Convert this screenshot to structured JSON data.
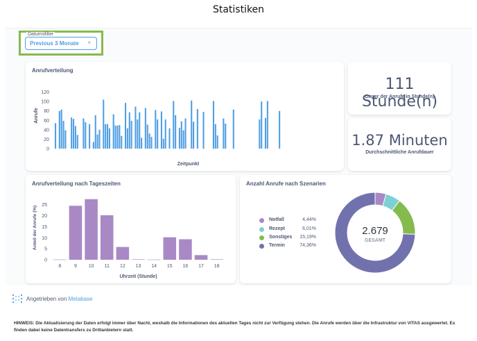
{
  "page": {
    "title": "Statistiken"
  },
  "filter": {
    "legend": "Datumsfilter",
    "value": "Previous 3 Monate",
    "close": "×"
  },
  "cards": {
    "duration": {
      "value": "111 Stunde(n)",
      "label": "Dauer der Anrufe in Stunde(n)"
    },
    "average": {
      "value": "1.87 Minuten",
      "label": "Durchschnittliche Anrufdauer"
    }
  },
  "chart_data": [
    {
      "type": "bar",
      "title": "Anrufverteilung",
      "xlabel": "Zeitpunkt",
      "ylabel": "Anrufe",
      "ylim": [
        0,
        140
      ],
      "yticks": [
        0,
        20,
        40,
        60,
        80,
        100,
        120
      ],
      "color": "#509ee3",
      "values": [
        54,
        0,
        80,
        83,
        59,
        39,
        0,
        0,
        66,
        63,
        48,
        29,
        0,
        0,
        64,
        56,
        0,
        52,
        0,
        14,
        71,
        30,
        40,
        0,
        104,
        52,
        52,
        43,
        0,
        73,
        49,
        49,
        50,
        27,
        0,
        97,
        43,
        77,
        59,
        0,
        89,
        62,
        77,
        23,
        0,
        86,
        51,
        32,
        25,
        0,
        82,
        62,
        0,
        79,
        21,
        62,
        0,
        43,
        0,
        101,
        71,
        0,
        44,
        58,
        39,
        64,
        0,
        0,
        102,
        57,
        0,
        84,
        0,
        0,
        78,
        0,
        0,
        0,
        0,
        101,
        52,
        28,
        0,
        0,
        64,
        53,
        0,
        0,
        0,
        83,
        0,
        0,
        0,
        0,
        0,
        0,
        0,
        0,
        0,
        0,
        0,
        0,
        62,
        100,
        0,
        65,
        101,
        0,
        0,
        0,
        0,
        0,
        80,
        0,
        0,
        0,
        0,
        0,
        0,
        0,
        0,
        0,
        0,
        0,
        0,
        0,
        0,
        0,
        0,
        0,
        0,
        0,
        0,
        0,
        0,
        0,
        0,
        0,
        0
      ]
    },
    {
      "type": "bar",
      "title": "Anrufverteilung nach Tageszeiten",
      "xlabel": "Uhrzeit (Stunde)",
      "ylabel": "Anteil der Anrufe (%)",
      "ylim": [
        0,
        29
      ],
      "yticks": [
        0,
        5,
        10,
        15,
        20,
        25
      ],
      "color": "#a989c5",
      "categories": [
        "8",
        "9",
        "10",
        "11",
        "12",
        "13",
        "14",
        "15",
        "16",
        "17",
        "18"
      ],
      "values": [
        0.1,
        24.5,
        27.5,
        20.2,
        5.8,
        0.2,
        0.1,
        10.2,
        9.3,
        2.1,
        0.2
      ]
    },
    {
      "type": "pie",
      "title": "Anzahl Anrufe nach Szenarien",
      "total": "2.679",
      "total_label": "GESAMT",
      "slices": [
        {
          "name": "Notfall",
          "value": 4.44,
          "label": "4,44%",
          "color": "#a989c5"
        },
        {
          "name": "Rezept",
          "value": 6.01,
          "label": "6,01%",
          "color": "#7ed0d4"
        },
        {
          "name": "Sonstiges",
          "value": 15.19,
          "label": "15,19%",
          "color": "#84bb4c"
        },
        {
          "name": "Termin",
          "value": 74.36,
          "label": "74,36%",
          "color": "#7172ad"
        }
      ]
    }
  ],
  "footer": {
    "powered_prefix": "Angetrieben von",
    "powered_link": "Metabase"
  },
  "note": "HINWEIS: Die Aktualisierung der Daten erfolgt immer über Nacht, weshalb die Informationen des aktuellen Tages nicht zur Verfügung stehen. Die Anrufe werden über die Infrastruktur von VITAS ausgewertet. Es finden dabei keine Datentransfers zu Drittanbietern statt."
}
